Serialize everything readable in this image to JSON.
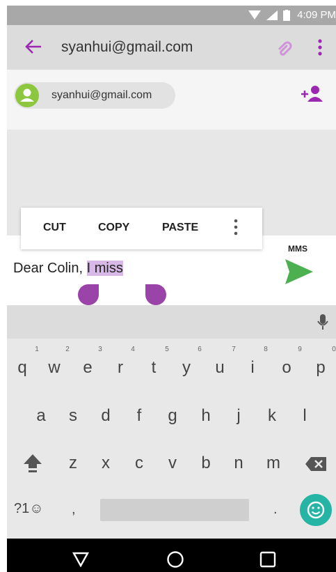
{
  "status_bar": {
    "time": "4:09 PM"
  },
  "app_bar": {
    "title": "syanhui@gmail.com"
  },
  "recipient": {
    "chip_label": "syanhui@gmail.com"
  },
  "context_menu": {
    "cut": "CUT",
    "copy": "COPY",
    "paste": "PASTE"
  },
  "compose": {
    "text_before": "Dear Colin, ",
    "text_selected": "I miss",
    "send_type": "MMS"
  },
  "keyboard": {
    "row1": [
      "q",
      "w",
      "e",
      "r",
      "t",
      "y",
      "u",
      "i",
      "o",
      "p"
    ],
    "row1_hints": [
      "1",
      "2",
      "3",
      "4",
      "5",
      "6",
      "7",
      "8",
      "9",
      "0"
    ],
    "row2": [
      "a",
      "s",
      "d",
      "f",
      "g",
      "h",
      "j",
      "k",
      "l"
    ],
    "row3": [
      "z",
      "x",
      "c",
      "v",
      "b",
      "n",
      "m"
    ],
    "symbols_label": "?1☺",
    "comma": ",",
    "period": "."
  },
  "colors": {
    "accent": "#9c27b0",
    "send": "#4caf50",
    "emoji_button": "#26b4a4",
    "selection": "#d7b8e6"
  }
}
